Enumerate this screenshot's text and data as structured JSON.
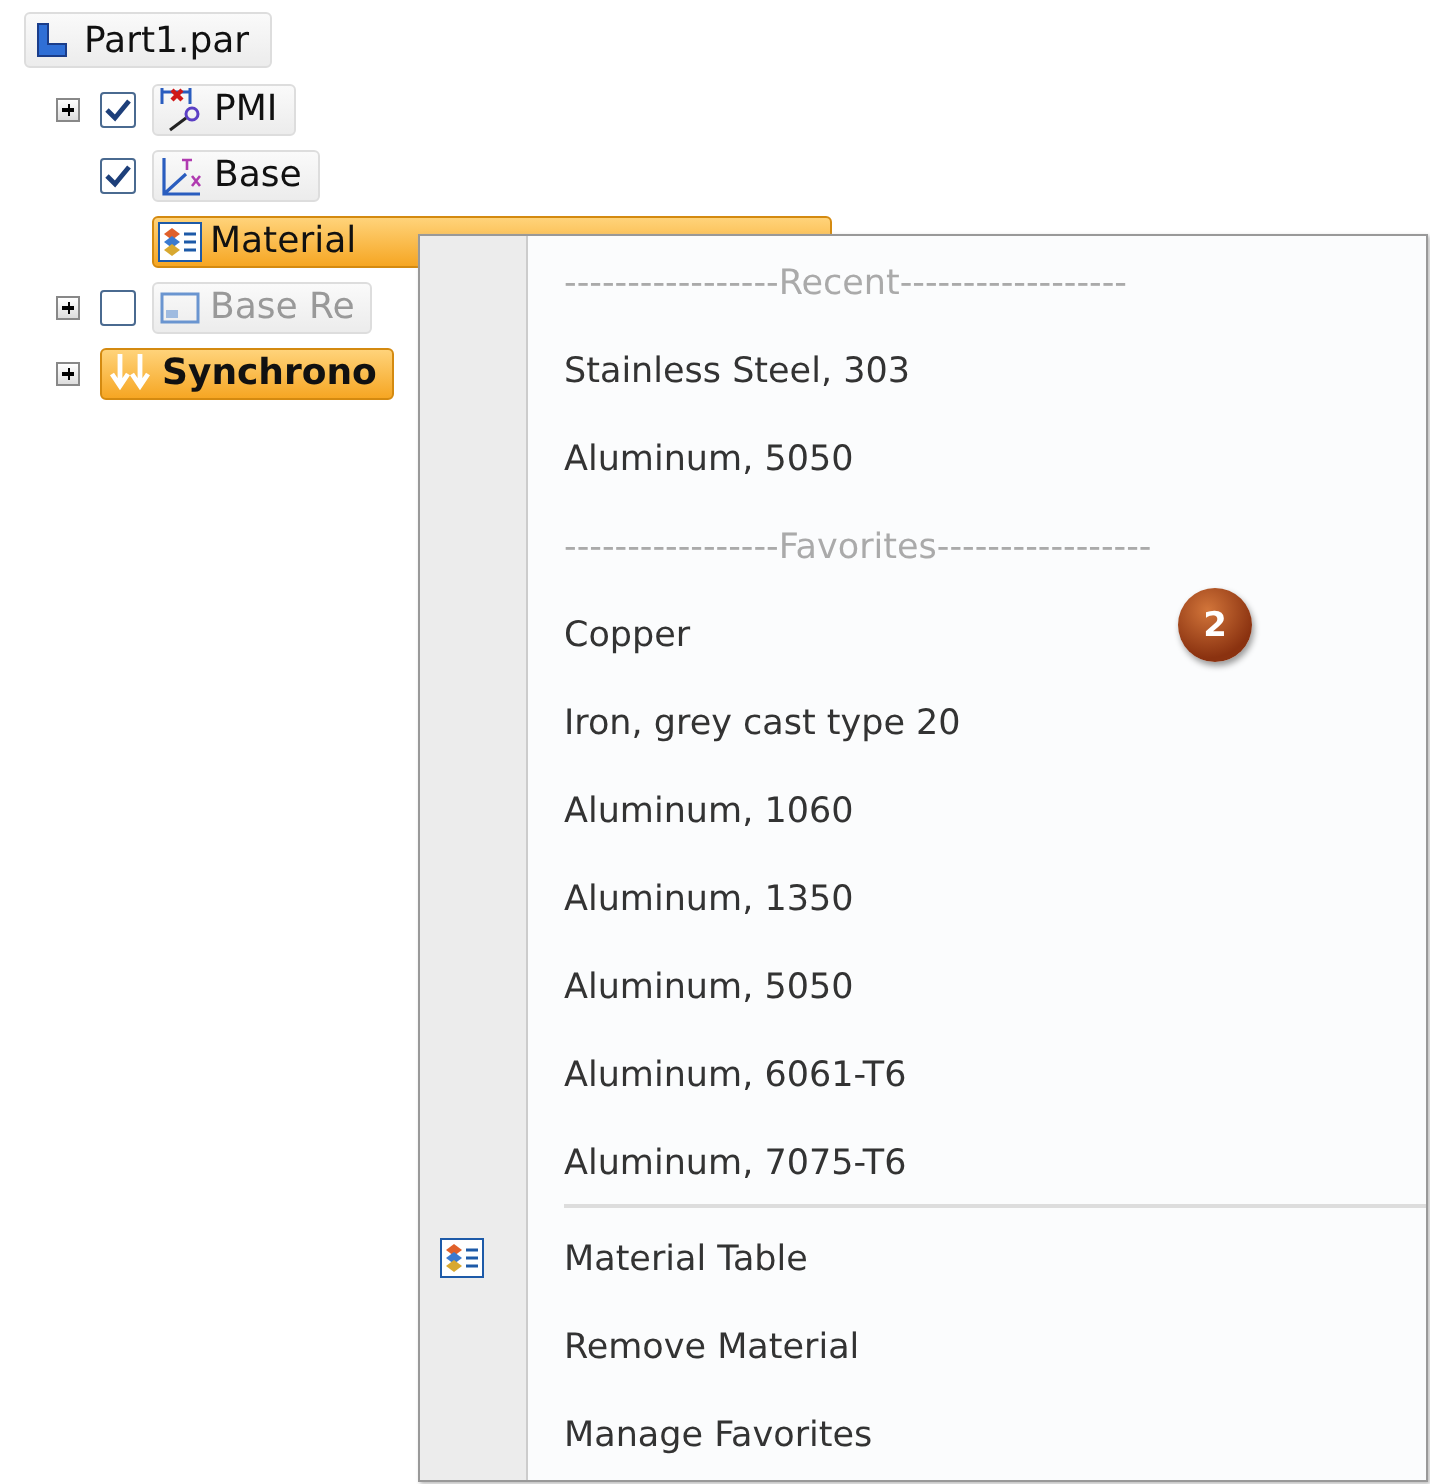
{
  "tree": {
    "root": {
      "label": "Part1.par"
    },
    "items": [
      {
        "label": "PMI",
        "kind": "pmi",
        "expandable": true,
        "checked": true,
        "selected": false,
        "disabled": false
      },
      {
        "label": "Base",
        "kind": "base",
        "expandable": false,
        "checked": true,
        "selected": false,
        "disabled": false
      },
      {
        "label": "Material",
        "kind": "material",
        "expandable": false,
        "selected": true,
        "disabled": false
      },
      {
        "label": "Base Re",
        "kind": "sketch",
        "expandable": true,
        "checked": false,
        "selected": false,
        "disabled": true
      },
      {
        "label": "Synchrono",
        "kind": "sync",
        "expandable": true,
        "selected": true,
        "disabled": false
      }
    ]
  },
  "context_menu": {
    "items": [
      {
        "kind": "header",
        "label": "-----------------Recent------------------"
      },
      {
        "kind": "item",
        "label": "Stainless Steel, 303"
      },
      {
        "kind": "item",
        "label": "Aluminum, 5050"
      },
      {
        "kind": "header",
        "label": "-----------------Favorites-----------------"
      },
      {
        "kind": "item",
        "label": "Copper"
      },
      {
        "kind": "item",
        "label": "Iron, grey cast type 20"
      },
      {
        "kind": "item",
        "label": "Aluminum, 1060"
      },
      {
        "kind": "item",
        "label": "Aluminum, 1350"
      },
      {
        "kind": "item",
        "label": "Aluminum, 5050"
      },
      {
        "kind": "item",
        "label": "Aluminum, 6061-T6"
      },
      {
        "kind": "item",
        "label": "Aluminum, 7075-T6"
      },
      {
        "kind": "separator"
      },
      {
        "kind": "item",
        "label": "Material Table",
        "icon": true
      },
      {
        "kind": "item",
        "label": "Remove Material"
      },
      {
        "kind": "item",
        "label": "Manage Favorites"
      }
    ]
  },
  "callout": {
    "label": "2"
  }
}
